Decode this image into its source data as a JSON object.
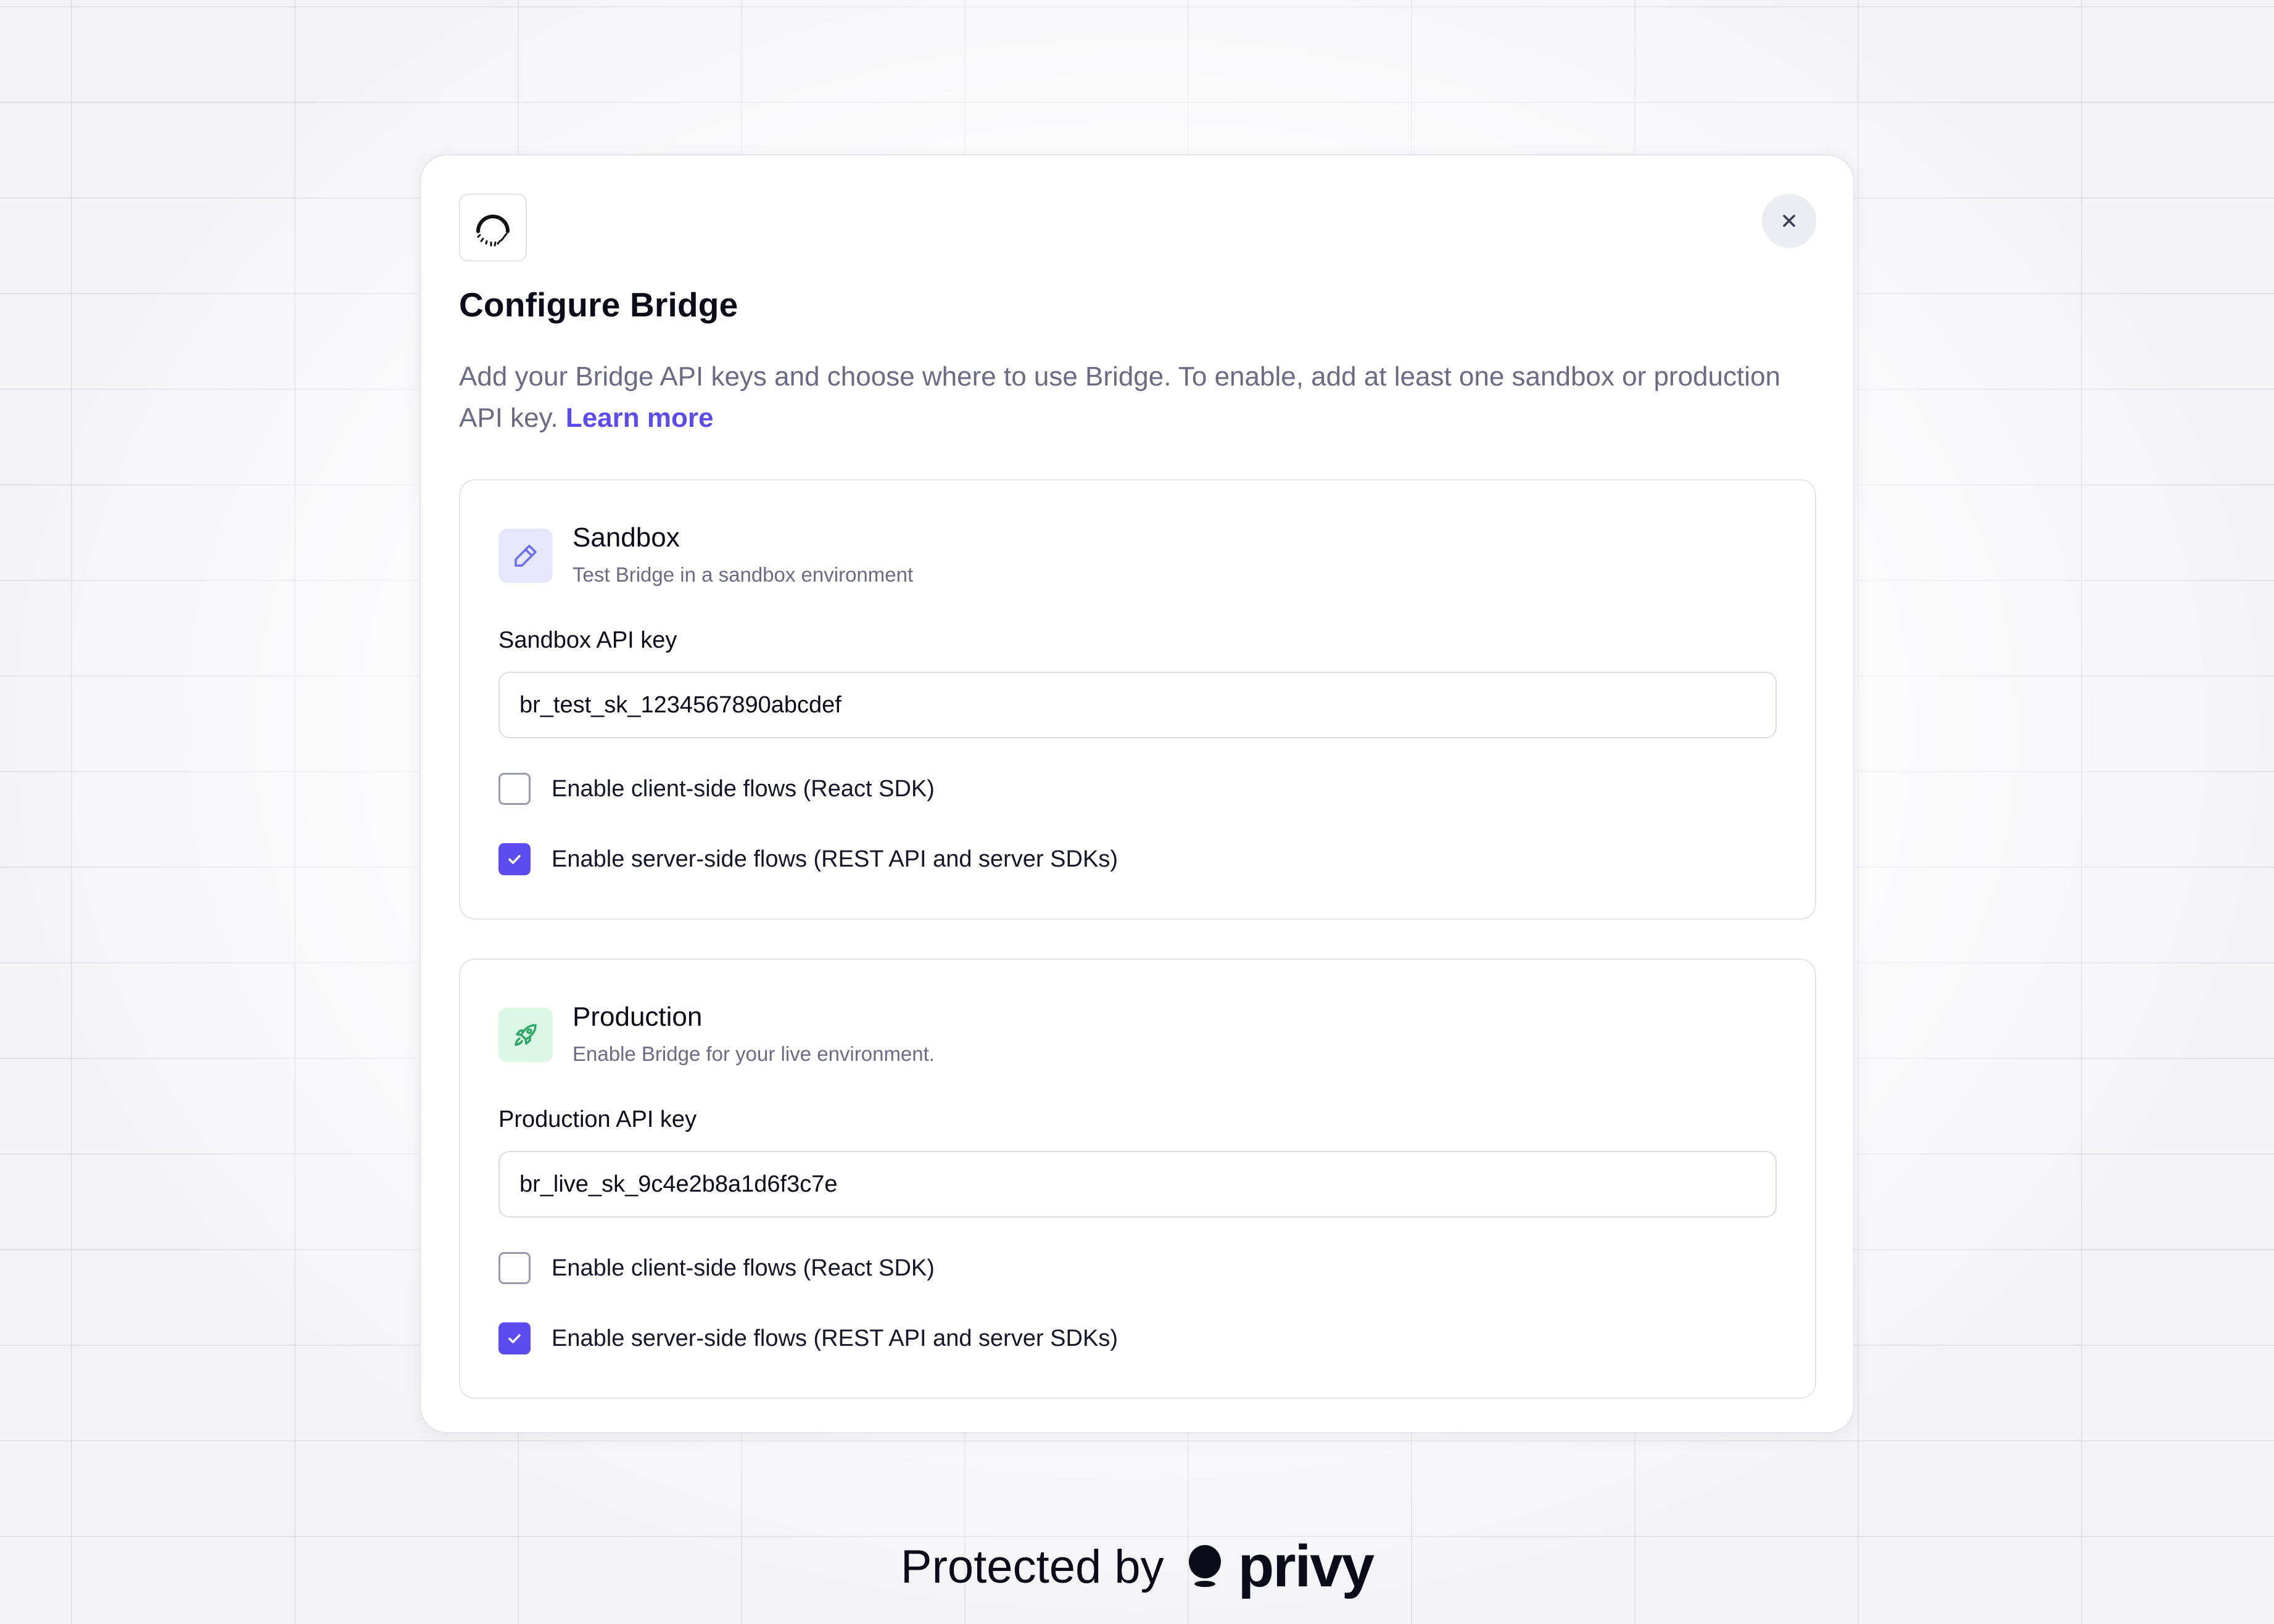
{
  "modal": {
    "logo_icon": "bridge-spinner-logo-icon",
    "close_icon": "close-x-icon",
    "title": "Configure Bridge",
    "description": "Add your Bridge API keys and choose where to use Bridge. To enable, add at least one sandbox or production API key.",
    "learn_more": "Learn more"
  },
  "sections": {
    "sandbox": {
      "icon": "pencil-icon",
      "title": "Sandbox",
      "subtitle": "Test Bridge in a sandbox environment",
      "field_label": "Sandbox API key",
      "field_value": "br_test_sk_1234567890abcdef",
      "client_label": "Enable client-side flows (React SDK)",
      "client_checked": false,
      "server_label": "Enable server-side flows (REST API and server SDKs)",
      "server_checked": true
    },
    "production": {
      "icon": "rocket-icon",
      "title": "Production",
      "subtitle": "Enable Bridge for your live environment.",
      "field_label": "Production API key",
      "field_value": "br_live_sk_9c4e2b8a1d6f3c7e",
      "client_label": "Enable client-side flows (React SDK)",
      "client_checked": false,
      "server_label": "Enable server-side flows (REST API and server SDKs)",
      "server_checked": true
    }
  },
  "footer": {
    "protected_by": "Protected by",
    "brand": "privy",
    "brand_icon": "privy-logo-icon"
  },
  "colors": {
    "accent": "#5b4cf0",
    "muted_text": "#6b6b85",
    "sandbox_icon_bg": "#e6e7fb",
    "production_icon_bg": "#dbf7e6",
    "production_icon": "#2fa865"
  }
}
